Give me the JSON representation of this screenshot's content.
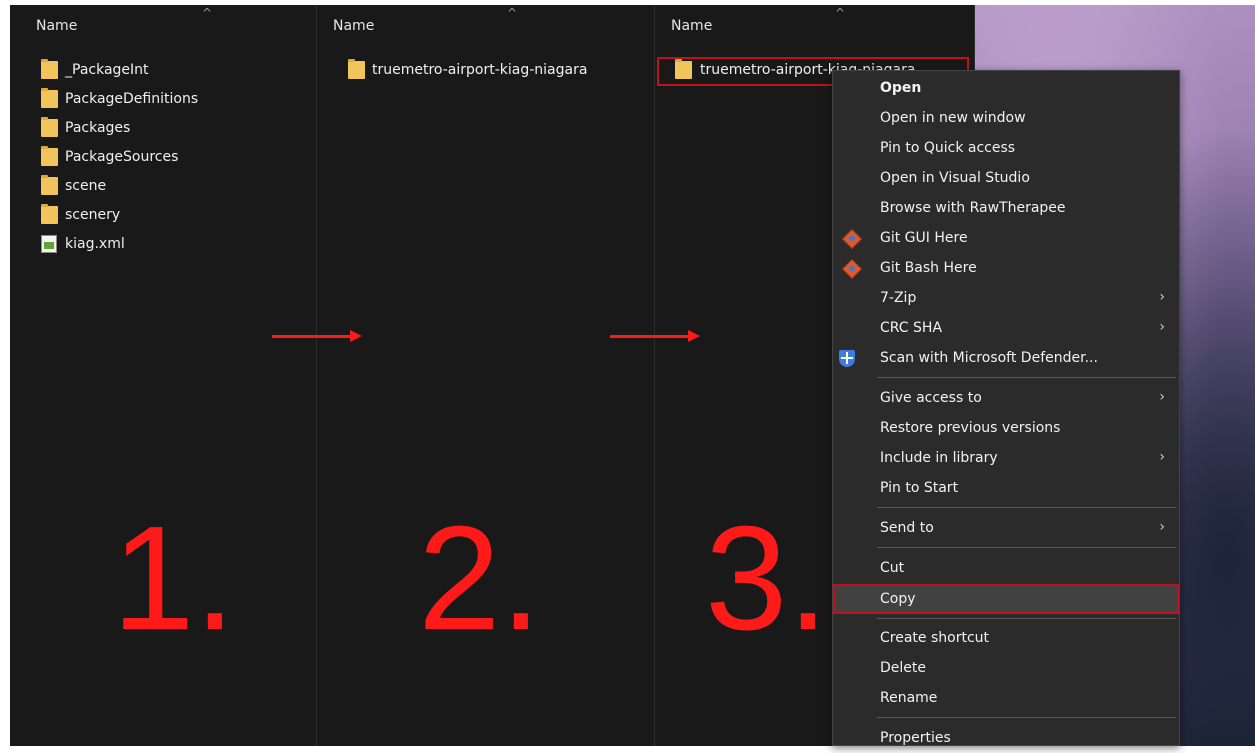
{
  "panes": [
    {
      "column_header": "Name",
      "items": [
        {
          "name": "_PackageInt",
          "icon": "folder-icon"
        },
        {
          "name": "PackageDefinitions",
          "icon": "folder-icon"
        },
        {
          "name": "Packages",
          "icon": "folder-icon"
        },
        {
          "name": "PackageSources",
          "icon": "folder-icon"
        },
        {
          "name": "scene",
          "icon": "folder-icon"
        },
        {
          "name": "scenery",
          "icon": "folder-icon"
        },
        {
          "name": "kiag.xml",
          "icon": "xml-file-icon"
        }
      ]
    },
    {
      "column_header": "Name",
      "items": [
        {
          "name": "truemetro-airport-kiag-niagara",
          "icon": "folder-icon"
        }
      ]
    },
    {
      "column_header": "Name",
      "items": [
        {
          "name": "truemetro-airport-kiag-niagara",
          "icon": "folder-icon",
          "selected": true
        }
      ]
    }
  ],
  "annotations": {
    "step1": "1.",
    "step2": "2.",
    "step3": "3.",
    "accent_color": "#ff1a1a"
  },
  "context_menu": {
    "items": [
      {
        "label": "Open",
        "bold": true
      },
      {
        "label": "Open in new window"
      },
      {
        "label": "Pin to Quick access"
      },
      {
        "label": "Open in Visual Studio"
      },
      {
        "label": "Browse with RawTherapee"
      },
      {
        "label": "Git GUI Here",
        "icon": "git-icon"
      },
      {
        "label": "Git Bash Here",
        "icon": "git-icon"
      },
      {
        "label": "7-Zip",
        "submenu": true
      },
      {
        "label": "CRC SHA",
        "submenu": true
      },
      {
        "label": "Scan with Microsoft Defender...",
        "icon": "defender-shield-icon"
      },
      {
        "label": "Give access to",
        "submenu": true
      },
      {
        "label": "Restore previous versions"
      },
      {
        "label": "Include in library",
        "submenu": true
      },
      {
        "label": "Pin to Start"
      },
      {
        "label": "Send to",
        "submenu": true
      },
      {
        "label": "Cut"
      },
      {
        "label": "Copy",
        "highlighted": true
      },
      {
        "label": "Create shortcut"
      },
      {
        "label": "Delete"
      },
      {
        "label": "Rename"
      },
      {
        "label": "Properties"
      }
    ],
    "submenu_glyph": "›"
  },
  "sort_glyph": "^"
}
